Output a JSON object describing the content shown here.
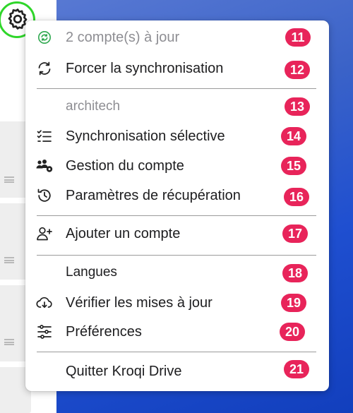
{
  "menu": {
    "status": {
      "label": "2 compte(s) à jour",
      "badge": "11"
    },
    "force_sync": {
      "label": "Forcer la synchronisation",
      "badge": "12"
    },
    "account": {
      "label": "architech",
      "badge": "13"
    },
    "selective_sync": {
      "label": "Synchronisation sélective",
      "badge": "14"
    },
    "manage_account": {
      "label": "Gestion du compte",
      "badge": "15"
    },
    "recovery_settings": {
      "label": "Paramètres de récupération",
      "badge": "16"
    },
    "add_account": {
      "label": "Ajouter un compte",
      "badge": "17"
    },
    "languages": {
      "label": "Langues",
      "badge": "18"
    },
    "check_updates": {
      "label": "Vérifier les mises à jour",
      "badge": "19"
    },
    "preferences": {
      "label": "Préférences",
      "badge": "20"
    },
    "quit": {
      "label": "Quitter Kroqi Drive",
      "badge": "21"
    }
  },
  "colors": {
    "badge": "#e8245a",
    "status_ok": "#2fa84f",
    "highlight_ring": "#2fd62a",
    "desktop": "#1f4fd0"
  },
  "icons": {
    "gear": "gear-icon",
    "status": "sync-ok-icon",
    "force_sync": "sync-arrows-icon",
    "selective_sync": "checklist-icon",
    "manage_account": "users-gear-icon",
    "recovery_settings": "history-icon",
    "add_account": "user-plus-icon",
    "check_updates": "cloud-download-icon",
    "preferences": "sliders-icon"
  }
}
